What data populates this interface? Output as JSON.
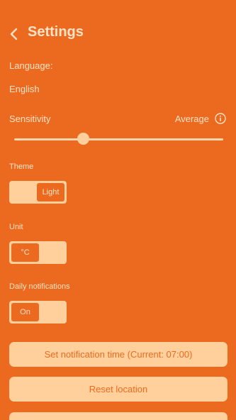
{
  "header": {
    "title": "Settings"
  },
  "language": {
    "label": "Language:",
    "value": "English"
  },
  "sensitivity": {
    "label": "Sensitivity",
    "value": "Average",
    "slider_level": 0.33
  },
  "theme": {
    "label": "Theme",
    "selected": "Light"
  },
  "unit": {
    "label": "Unit",
    "selected": "°C"
  },
  "notifications": {
    "label": "Daily notifications",
    "selected": "On"
  },
  "actions": {
    "set_time_label": "Set notification time (Current: 07:00)",
    "reset_location_label": "Reset location"
  },
  "colors": {
    "background": "#EC6A1F",
    "text": "#FFE3C6",
    "control_fill": "#FFD09B"
  },
  "icons": {
    "back": "chevron-left-icon",
    "info": "info-icon"
  }
}
